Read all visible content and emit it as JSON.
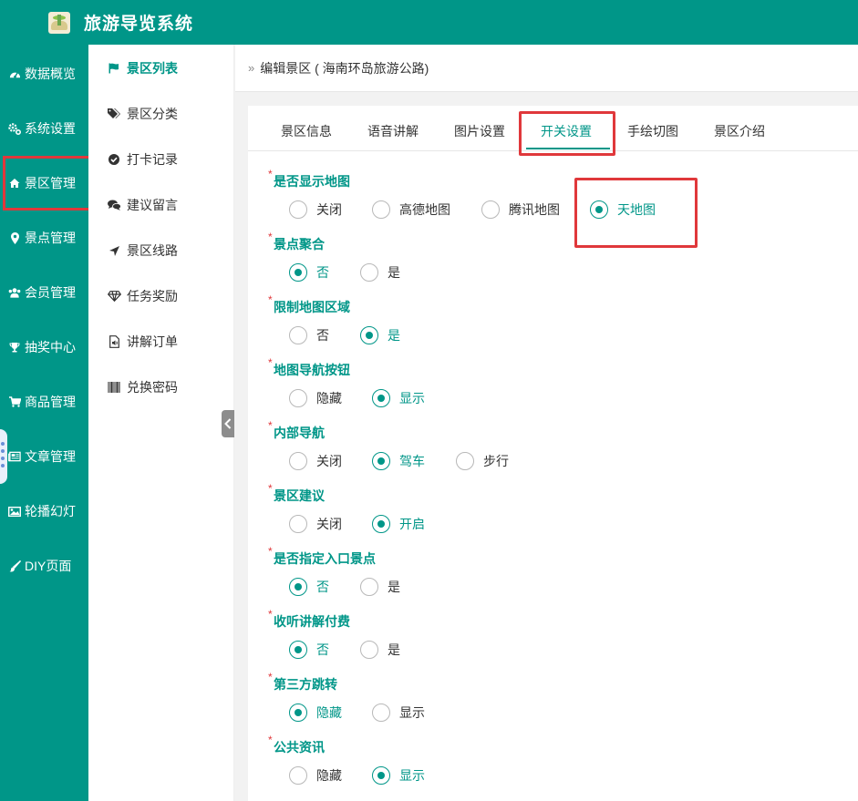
{
  "header": {
    "title": "旅游导览系统"
  },
  "leftnav": {
    "items": [
      {
        "label": "数据概览",
        "icon": "dashboard-icon"
      },
      {
        "label": "系统设置",
        "icon": "cogs-icon"
      },
      {
        "label": "景区管理",
        "icon": "home-icon",
        "active": true
      },
      {
        "label": "景点管理",
        "icon": "map-marker-icon"
      },
      {
        "label": "会员管理",
        "icon": "users-icon"
      },
      {
        "label": "抽奖中心",
        "icon": "trophy-icon"
      },
      {
        "label": "商品管理",
        "icon": "cart-icon"
      },
      {
        "label": "文章管理",
        "icon": "newspaper-icon"
      },
      {
        "label": "轮播幻灯",
        "icon": "image-icon"
      },
      {
        "label": "DIY页面",
        "icon": "brush-icon"
      }
    ]
  },
  "subnav": {
    "items": [
      {
        "label": "景区列表",
        "icon": "flag-icon",
        "active": true
      },
      {
        "label": "景区分类",
        "icon": "tags-icon"
      },
      {
        "label": "打卡记录",
        "icon": "check-circle-icon"
      },
      {
        "label": "建议留言",
        "icon": "comments-icon"
      },
      {
        "label": "景区线路",
        "icon": "location-arrow-icon"
      },
      {
        "label": "任务奖励",
        "icon": "diamond-icon"
      },
      {
        "label": "讲解订单",
        "icon": "audio-file-icon"
      },
      {
        "label": "兑换密码",
        "icon": "barcode-icon"
      }
    ]
  },
  "breadcrumb": {
    "text": "编辑景区 ( 海南环岛旅游公路)"
  },
  "tabs": [
    {
      "label": "景区信息"
    },
    {
      "label": "语音讲解"
    },
    {
      "label": "图片设置"
    },
    {
      "label": "开关设置",
      "active": true
    },
    {
      "label": "手绘切图"
    },
    {
      "label": "景区介绍"
    }
  ],
  "fields": [
    {
      "label": "是否显示地图",
      "options": [
        "关闭",
        "高德地图",
        "腾讯地图",
        "天地图"
      ],
      "selected": "天地图"
    },
    {
      "label": "景点聚合",
      "options": [
        "否",
        "是"
      ],
      "selected": "否"
    },
    {
      "label": "限制地图区域",
      "options": [
        "否",
        "是"
      ],
      "selected": "是"
    },
    {
      "label": "地图导航按钮",
      "options": [
        "隐藏",
        "显示"
      ],
      "selected": "显示"
    },
    {
      "label": "内部导航",
      "options": [
        "关闭",
        "驾车",
        "步行"
      ],
      "selected": "驾车"
    },
    {
      "label": "景区建议",
      "options": [
        "关闭",
        "开启"
      ],
      "selected": "开启"
    },
    {
      "label": "是否指定入口景点",
      "options": [
        "否",
        "是"
      ],
      "selected": "否"
    },
    {
      "label": "收听讲解付费",
      "options": [
        "否",
        "是"
      ],
      "selected": "否"
    },
    {
      "label": "第三方跳转",
      "options": [
        "隐藏",
        "显示"
      ],
      "selected": "隐藏"
    },
    {
      "label": "公共资讯",
      "options": [
        "隐藏",
        "显示"
      ],
      "selected": "显示"
    }
  ],
  "colors": {
    "primary": "#009688",
    "highlight": "#e0383b",
    "required": "#e0383b"
  }
}
